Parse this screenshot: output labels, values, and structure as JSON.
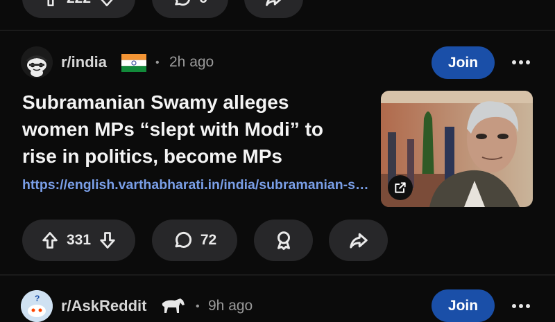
{
  "prev_post": {
    "upvote_count": "222",
    "comment_count": "6"
  },
  "post": {
    "subreddit": "r/india",
    "separator": "•",
    "time_ago": "2h ago",
    "join_label": "Join",
    "title": "Subramanian Swamy alleges women MPs “slept with Modi” to rise in politics, become MPs",
    "link_text": "https://english.varthabharati.in/india/subramanian-swamy-alleges-women-mps-slept-with-modi",
    "upvote_count": "331",
    "comment_count": "72",
    "flag_icon": "india-flag-icon",
    "thumb_overlay_icon": "external-link-icon"
  },
  "next_post": {
    "subreddit": "r/AskReddit",
    "separator": "•",
    "time_ago": "9h ago",
    "join_label": "Join"
  },
  "colors": {
    "background": "#0b0b0b",
    "pill": "#272729",
    "join": "#1a4fa8",
    "link": "#7a9fe8"
  }
}
